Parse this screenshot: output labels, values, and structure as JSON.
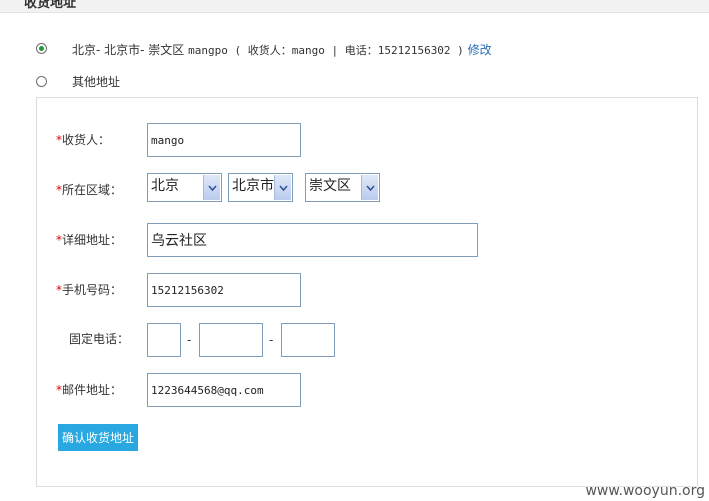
{
  "section": {
    "title": "收货地址"
  },
  "address_options": [
    {
      "text": "北京- 北京市- 崇文区",
      "detail": "mangpo ( 收货人：mango | 电话：15212156302 )",
      "link": "修改",
      "checked": true
    },
    {
      "text": "其他地址",
      "checked": false
    }
  ],
  "form": {
    "required_mark": "*",
    "receiver": {
      "label": "收货人：",
      "value": "mango"
    },
    "region": {
      "label": "所在区域：",
      "province": "北京",
      "city": "北京市",
      "district": "崇文区"
    },
    "address": {
      "label": "详细地址：",
      "value": "乌云社区"
    },
    "mobile": {
      "label": "手机号码：",
      "value": "15212156302"
    },
    "phone": {
      "label": "固定电话：",
      "area": "",
      "number": "",
      "ext": "",
      "sep1": "-",
      "sep2": "-"
    },
    "email": {
      "label": "邮件地址：",
      "value": "1223644568@qq.com"
    },
    "submit_label": "确认收货地址"
  },
  "watermark": "www.wooyun.org",
  "colors": {
    "accent": "#28a7e1",
    "link": "#2a6db5",
    "required": "#dd0000",
    "radio_checked": "#1f9b3b"
  }
}
